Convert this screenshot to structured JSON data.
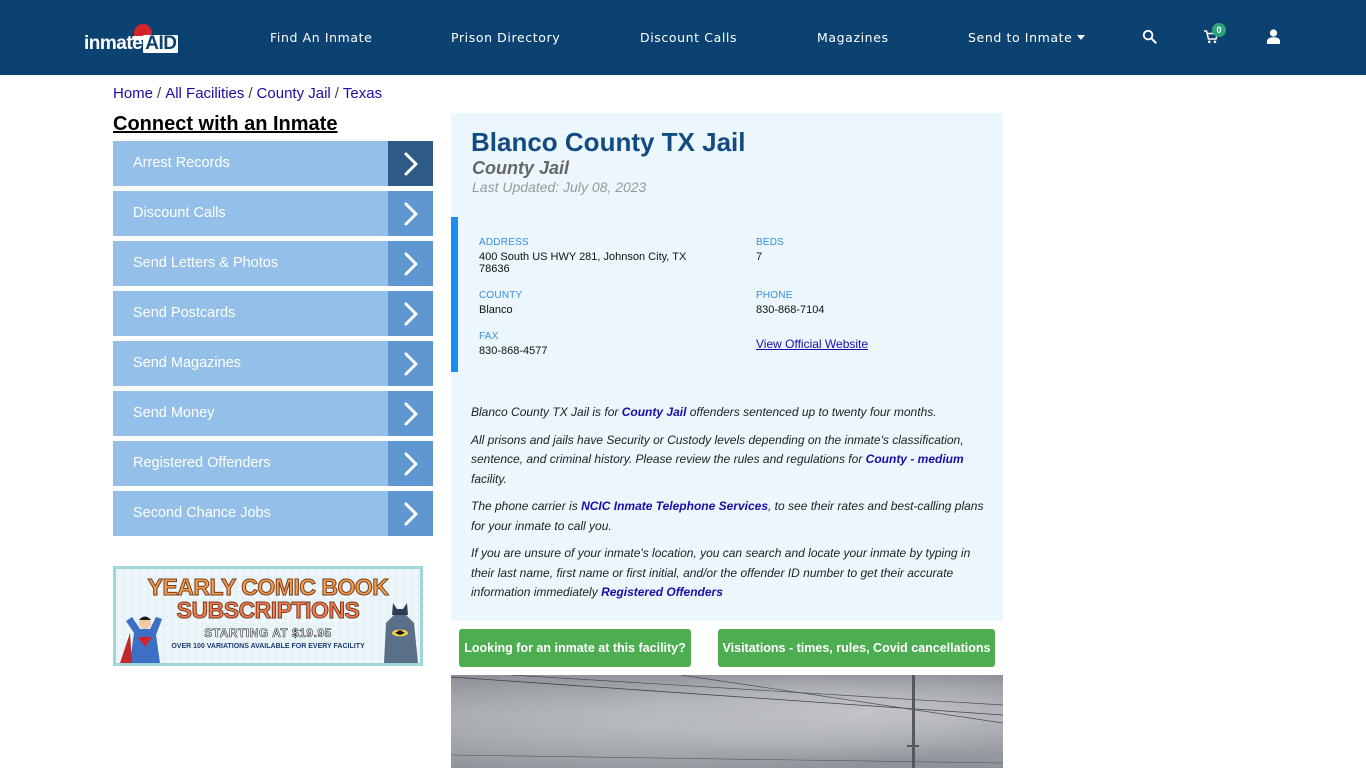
{
  "header": {
    "logo": {
      "text_main": "inmate",
      "text_accent": "AID"
    },
    "nav": [
      {
        "label": "Find An Inmate"
      },
      {
        "label": "Prison Directory"
      },
      {
        "label": "Discount Calls"
      },
      {
        "label": "Magazines"
      },
      {
        "label": "Send to Inmate",
        "has_dropdown": true
      }
    ],
    "icons": {
      "search": "search-icon",
      "cart": "cart-icon",
      "user": "user-icon"
    },
    "cart_count": "0"
  },
  "breadcrumb": [
    {
      "label": "Home"
    },
    {
      "label": "All Facilities"
    },
    {
      "label": "County Jail"
    },
    {
      "label": "Texas"
    }
  ],
  "sidebar": {
    "title": "Connect with an Inmate",
    "items": [
      {
        "label": "Arrest Records",
        "active": true
      },
      {
        "label": "Discount Calls"
      },
      {
        "label": "Send Letters & Photos"
      },
      {
        "label": "Send Postcards"
      },
      {
        "label": "Send Magazines"
      },
      {
        "label": "Send Money"
      },
      {
        "label": "Registered Offenders"
      },
      {
        "label": "Second Chance Jobs"
      }
    ],
    "ad": {
      "line1": "YEARLY COMIC BOOK",
      "line2": "SUBSCRIPTIONS",
      "line3": "STARTING AT $19.95",
      "line4": "OVER 100 VARIATIONS AVAILABLE FOR EVERY FACILITY"
    }
  },
  "facility": {
    "name": "Blanco County TX Jail",
    "type": "County Jail",
    "last_updated": "Last Updated: July 08, 2023",
    "address_label": "ADDRESS",
    "address_line1": "400 South US HWY 281, Johnson City, TX",
    "address_line2": "78636",
    "beds_label": "BEDS",
    "beds": "7",
    "county_label": "COUNTY",
    "county": "Blanco",
    "phone_label": "PHONE",
    "phone": "830-868-7104",
    "fax_label": "FAX",
    "fax": "830-868-4577",
    "website_link": "View Official Website"
  },
  "description": {
    "p1_a": "Blanco County TX Jail is for ",
    "p1_link": "County Jail",
    "p1_b": " offenders sentenced up to twenty four months.",
    "p2_a": "All prisons and jails have Security or Custody levels depending on the inmate's classification, sentence, and criminal history. Please review the rules and regulations for ",
    "p2_link": "County - medium",
    "p2_b": " facility.",
    "p3_a": "The phone carrier is ",
    "p3_link": "NCIC Inmate Telephone Services",
    "p3_b": ", to see their rates and best-calling plans for your inmate to call you.",
    "p4_a": "If you are unsure of your inmate's location, you can search and locate your inmate by typing in their last name, first name or first initial, and/or the offender ID number to get their accurate information immediately ",
    "p4_link": "Registered Offenders"
  },
  "buttons": {
    "find_inmate": "Looking for an inmate at this facility?",
    "visitations": "Visitations - times, rules, Covid cancellations"
  },
  "colors": {
    "header_bg": "#0c4271",
    "sidebar_item": "#94bfe8",
    "sidebar_arrow": "#5f97d1",
    "sidebar_arrow_active": "#2e5a88",
    "card_bg": "#ebf6fd",
    "accent_bar": "#198ef0",
    "green_button": "#4cae50",
    "title": "#134b80"
  }
}
